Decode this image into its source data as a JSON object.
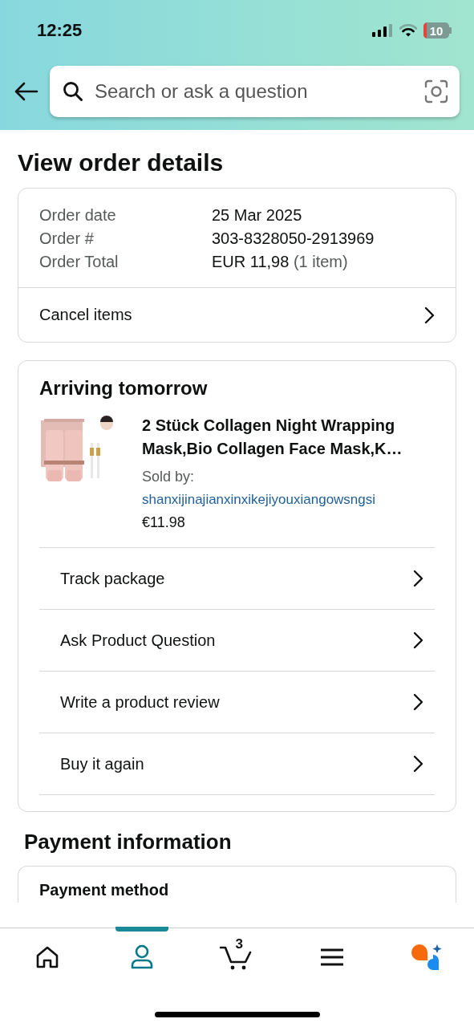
{
  "status_bar": {
    "time": "12:25",
    "battery": "10"
  },
  "search": {
    "placeholder": "Search or ask a question"
  },
  "page_title": "View order details",
  "order_summary": {
    "rows": [
      {
        "label": "Order date",
        "value": "25 Mar 2025"
      },
      {
        "label": "Order #",
        "value": "303-8328050-2913969"
      },
      {
        "label": "Order Total",
        "value": "EUR 11,98",
        "note": "(1 item)"
      }
    ],
    "action": "Cancel items"
  },
  "shipment": {
    "heading": "Arriving tomorrow",
    "product": {
      "kind": "picture",
      "title": "2 Stück Collagen Night Wrapping Mask,Bio Collagen Face Mask,K…",
      "sold_by_label": "Sold by:",
      "seller": "shanxijinajianxinxikejiyouxiangowsngsi",
      "price": "€11.98"
    },
    "actions": [
      "Track package",
      "Ask Product Question",
      "Write a product review",
      "Buy it again"
    ]
  },
  "payment": {
    "heading": "Payment information",
    "card_title": "Payment method"
  },
  "bottom_nav": [
    {
      "kind": "home",
      "selected": false
    },
    {
      "kind": "account",
      "selected": true
    },
    {
      "kind": "cart",
      "selected": false,
      "badge": "3"
    },
    {
      "kind": "menu",
      "selected": false
    },
    {
      "kind": "assistant",
      "selected": false
    }
  ]
}
